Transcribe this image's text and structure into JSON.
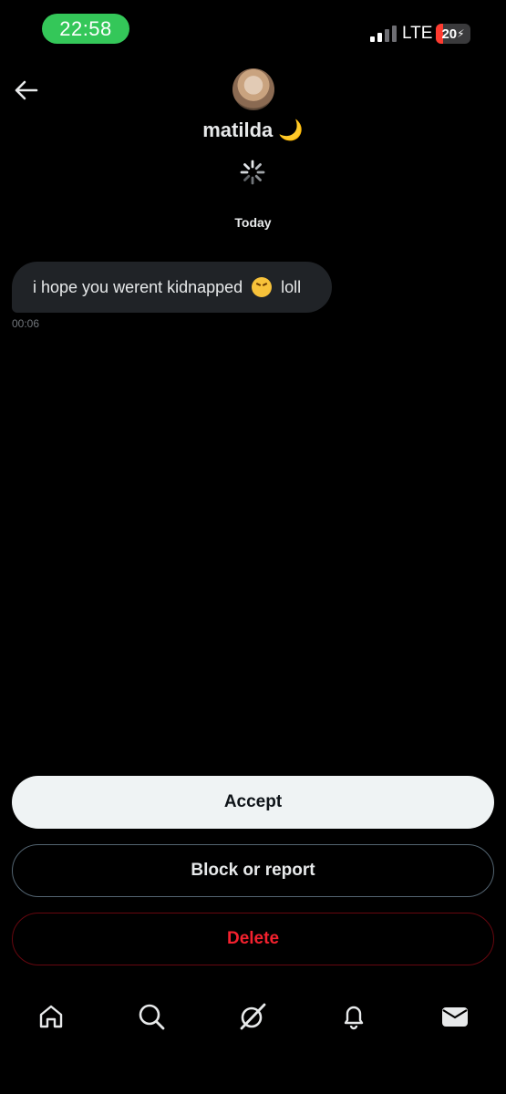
{
  "status_bar": {
    "time": "22:58",
    "network": "LTE",
    "battery": "20",
    "battery_level_percent": 20,
    "colors": {
      "time_pill": "#34c759",
      "battery_low": "#ff3b30"
    }
  },
  "header": {
    "contact_name": "matilda 🌙",
    "icons": {
      "back": "back-arrow-icon",
      "loading": "loading-spinner-icon"
    }
  },
  "conversation": {
    "date_divider": "Today",
    "messages": [
      {
        "text_before": "i hope you werent kidnapped",
        "emoji": "persevering-face-emoji",
        "text_after": "loll",
        "time": "00:06"
      }
    ]
  },
  "actions": {
    "accept": "Accept",
    "block_or_report": "Block or report",
    "delete": "Delete",
    "colors": {
      "accept_bg": "#eff3f4",
      "delete_text": "#f4212e"
    }
  },
  "bottom_nav": {
    "items": [
      "home-icon",
      "search-icon",
      "grok-icon",
      "notifications-bell-icon",
      "messages-envelope-icon"
    ]
  }
}
